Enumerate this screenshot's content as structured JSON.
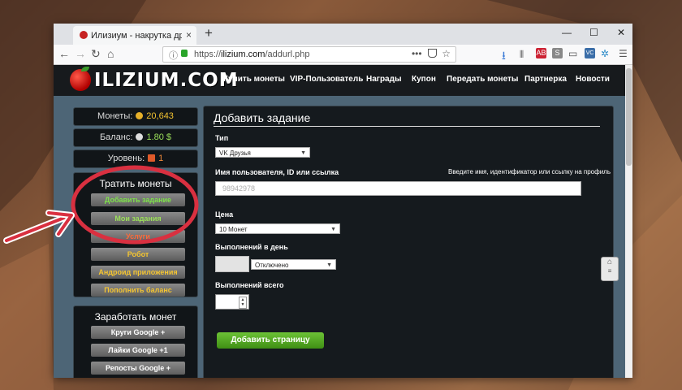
{
  "browser": {
    "tab_title": "Илизиум - накрутка друзей, п",
    "tab_close": "×",
    "new_tab": "+",
    "win_min": "—",
    "win_max": "☐",
    "win_close": "✕",
    "back": "←",
    "forward": "→",
    "reload": "↻",
    "home": "⌂",
    "url_info": "ⓘ",
    "url_prefix": "https://",
    "url_host": "ilizium.com",
    "url_path": "/addurl.php",
    "url_more": "•••",
    "toolbar_badges": {
      "ext1": "AB",
      "ext2": "S",
      "ext3": "VC"
    }
  },
  "site": {
    "logo_text": "ILIZIUM.COM",
    "menu": [
      "Купить монеты",
      "VIP-Пользователь",
      "Награды",
      "Купон",
      "Передать монеты",
      "Партнерка",
      "Новости"
    ]
  },
  "sidebar": {
    "coins_label": "Монеты:",
    "coins_value": "20,643",
    "balance_label": "Баланс:",
    "balance_value": "1.80 $",
    "level_label": "Уровень:",
    "level_value": "1",
    "spend_title": "Тратить монеты",
    "spend_items": [
      "Добавить задание",
      "Мои задания",
      "Услуги",
      "Робот",
      "Андроид приложения",
      "Пополнить баланс"
    ],
    "earn_title": "Заработать монет",
    "earn_items": [
      "Круги Google +",
      "Лайки Google +1",
      "Репосты Google +"
    ]
  },
  "form": {
    "title": "Добавить задание",
    "type_label": "Тип",
    "type_value": "VK Друзья",
    "username_label": "Имя пользователя, ID или ссылка",
    "username_hint": "Введите имя, идентификатор или ссылку на профиль",
    "username_value": "98942978",
    "price_label": "Цена",
    "price_value": "10 Монет",
    "daily_label": "Выполнений в день",
    "daily_value": "Отключено",
    "total_label": "Выполнений всего",
    "submit_label": "Добавить страницу"
  },
  "colors": {
    "accent_green": "#5fb12a",
    "coin_gold": "#f2c230",
    "annotation_red": "#d93040"
  }
}
